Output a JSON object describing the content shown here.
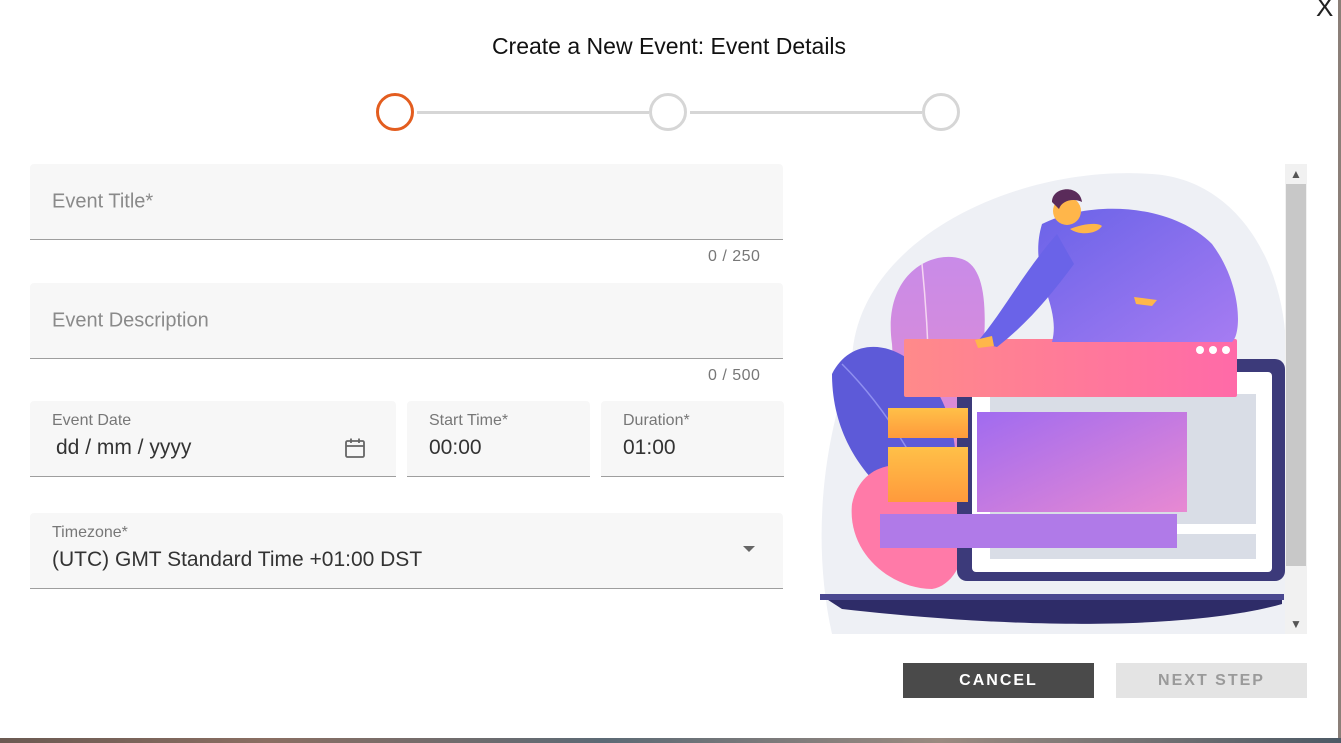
{
  "dialog": {
    "title": "Create a New Event: Event Details",
    "close_label": "X"
  },
  "stepper": {
    "steps": [
      "step-1",
      "step-2",
      "step-3"
    ],
    "active_step": 1,
    "active_color": "#e35d1f"
  },
  "form": {
    "event_title": {
      "placeholder": "Event Title*",
      "counter": "0 / 250"
    },
    "event_description": {
      "placeholder": "Event Description",
      "counter": "0 / 500"
    },
    "event_date": {
      "label": "Event Date",
      "value": "dd / mm / yyyy",
      "icon": "calendar-icon"
    },
    "start_time": {
      "label": "Start Time*",
      "value": "00:00"
    },
    "duration": {
      "label": "Duration*",
      "value": "01:00"
    },
    "timezone": {
      "label": "Timezone*",
      "value": "(UTC) GMT Standard Time +01:00 DST",
      "icon": "chevron-down-icon"
    }
  },
  "actions": {
    "cancel_label": "CANCEL",
    "next_label": "NEXT STEP"
  }
}
